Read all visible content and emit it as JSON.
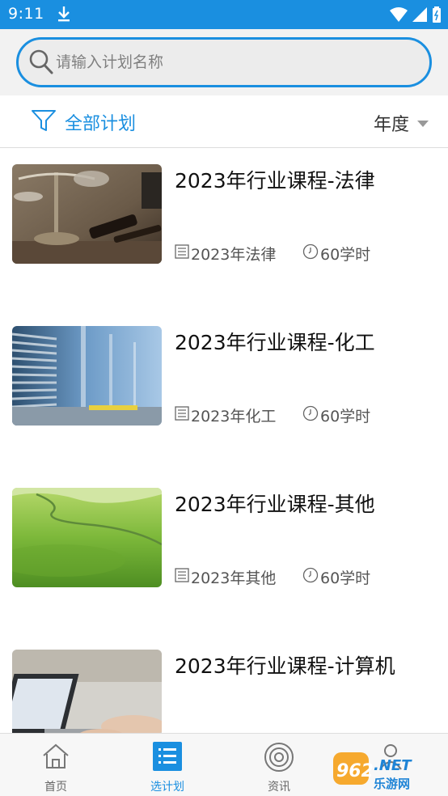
{
  "status_bar": {
    "time": "9:11"
  },
  "search": {
    "placeholder": "请输入计划名称"
  },
  "filter": {
    "left_label": "全部计划",
    "right_label": "年度"
  },
  "plans": [
    {
      "title": "2023年行业课程-法律",
      "category": "2023年法律",
      "hours": "60学时",
      "image": "scales-gavel-photo"
    },
    {
      "title": "2023年行业课程-化工",
      "category": "2023年化工",
      "hours": "60学时",
      "image": "industrial-warehouse-photo"
    },
    {
      "title": "2023年行业课程-其他",
      "category": "2023年其他",
      "hours": "60学时",
      "image": "green-field-photo"
    },
    {
      "title": "2023年行业课程-计算机",
      "category": "",
      "hours": "",
      "image": "laptop-typing-photo"
    }
  ],
  "bottom_nav": [
    {
      "label": "首页",
      "icon": "home-icon",
      "active": false
    },
    {
      "label": "选计划",
      "icon": "list-icon",
      "active": true
    },
    {
      "label": "资讯",
      "icon": "news-icon",
      "active": false
    },
    {
      "label": "",
      "icon": "profile-icon",
      "active": false
    }
  ],
  "watermark": {
    "number": "962",
    "suffix": ".NET",
    "site": "乐游网"
  },
  "colors": {
    "accent": "#1a8fe0",
    "text": "#111111",
    "meta": "#555555"
  }
}
